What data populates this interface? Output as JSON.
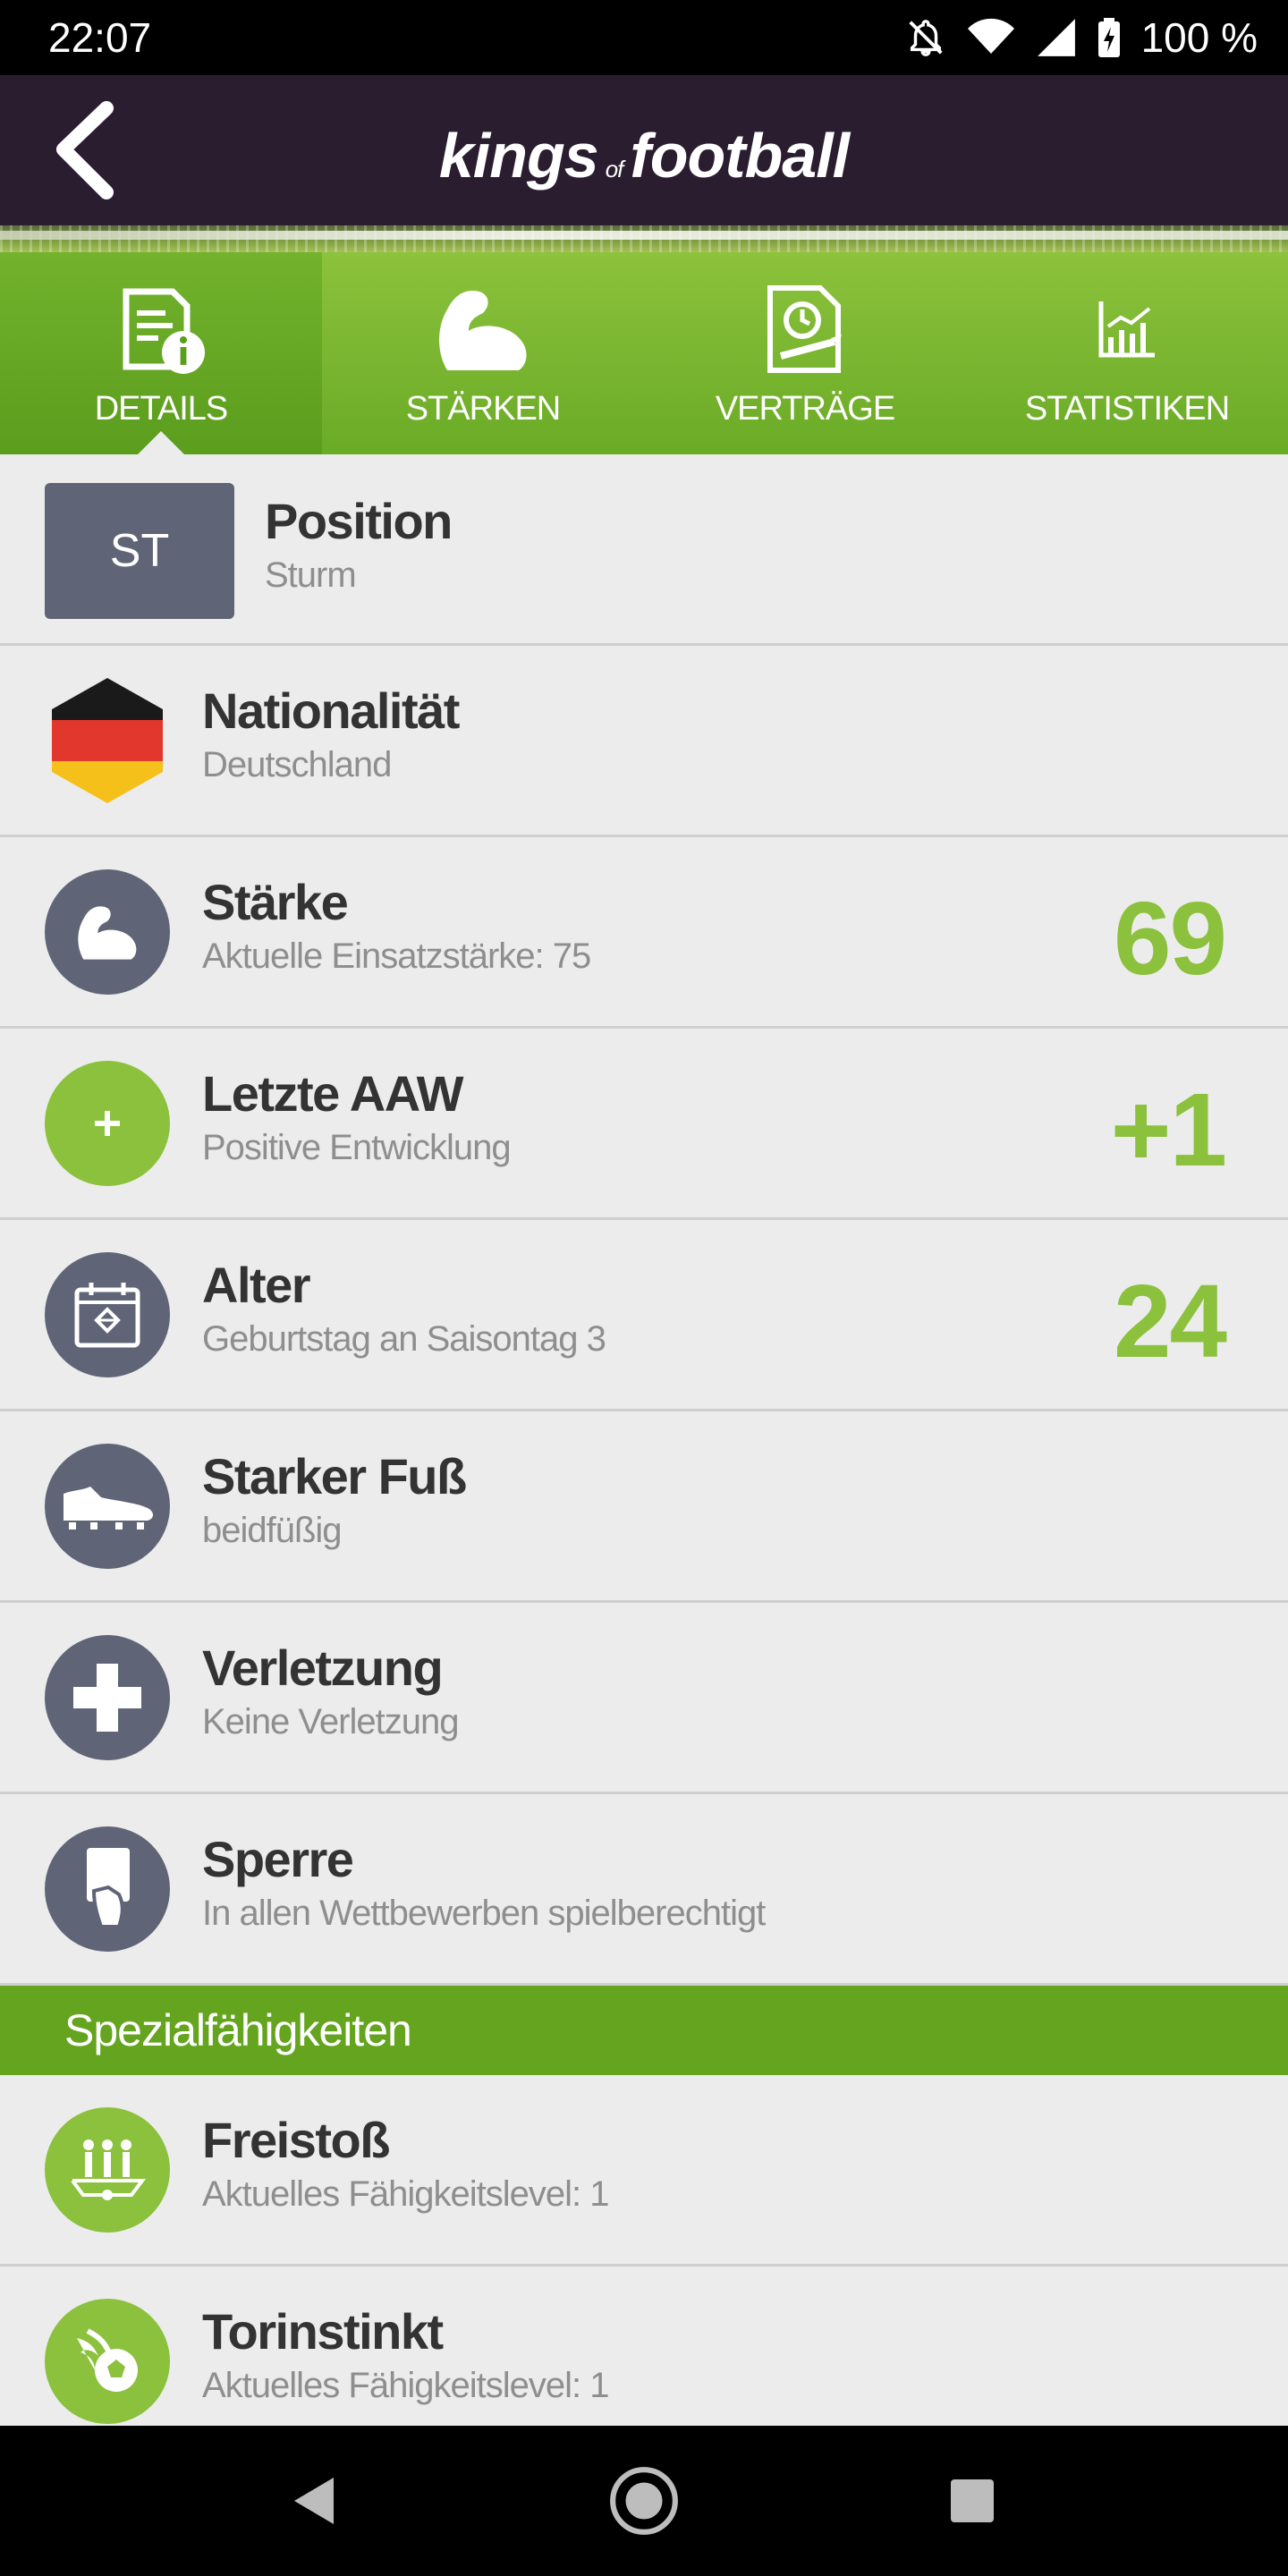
{
  "status_bar": {
    "time": "22:07",
    "battery": "100 %",
    "icons": [
      "notifications-off-icon",
      "wifi-icon",
      "signal-icon",
      "battery-charging-icon"
    ]
  },
  "header": {
    "logo_part1": "kings",
    "logo_part2": "of",
    "logo_part3": "football",
    "back_icon": "chevron-left-icon"
  },
  "tabs": [
    {
      "label": "DETAILS",
      "icon": "document-info-icon",
      "active": true
    },
    {
      "label": "STÄRKEN",
      "icon": "flexed-biceps-icon",
      "active": false
    },
    {
      "label": "VERTRÄGE",
      "icon": "contract-clock-icon",
      "active": false
    },
    {
      "label": "STATISTIKEN",
      "icon": "chart-icon",
      "active": false
    }
  ],
  "details": {
    "position": {
      "badge": "ST",
      "title": "Position",
      "subtitle": "Sturm"
    },
    "nationality": {
      "title": "Nationalität",
      "subtitle": "Deutschland",
      "flag_colors": [
        "#1a1a1a",
        "#e2372d",
        "#f5c01a"
      ]
    },
    "strength": {
      "title": "Stärke",
      "subtitle": "Aktuelle Einsatzstärke: 75",
      "value": "69"
    },
    "last_aaw": {
      "title": "Letzte AAW",
      "subtitle": "Positive Entwicklung",
      "value": "+1"
    },
    "age": {
      "title": "Alter",
      "subtitle": "Geburtstag an Saisontag 3",
      "value": "24"
    },
    "foot": {
      "title": "Starker Fuß",
      "subtitle": "beidfüßig"
    },
    "injury": {
      "title": "Verletzung",
      "subtitle": "Keine Verletzung"
    },
    "suspension": {
      "title": "Sperre",
      "subtitle": "In allen Wettbewerben spielberechtigt"
    }
  },
  "special": {
    "header": "Spezialfähigkeiten",
    "items": [
      {
        "title": "Freistoß",
        "subtitle": "Aktuelles Fähigkeitslevel: 1",
        "icon": "free-kick-wall-icon"
      },
      {
        "title": "Torinstinkt",
        "subtitle": "Aktuelles Fähigkeitslevel: 1",
        "icon": "flaming-ball-icon"
      }
    ]
  },
  "colors": {
    "accent_green": "#8bc13c",
    "header_dark": "#2a1d2f",
    "icon_grey": "#5f6576"
  }
}
